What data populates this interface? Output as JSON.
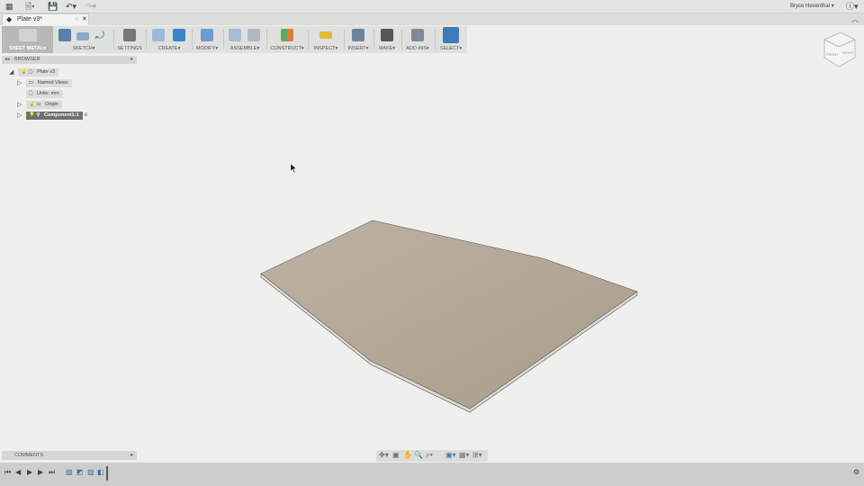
{
  "app": {
    "user_name": "Bryce Heventhal",
    "help_label": "?"
  },
  "document_tab": {
    "title": "Plate v3*"
  },
  "toolbar": {
    "workspace": "SHEET METAL",
    "groups": [
      {
        "label": "SKETCH",
        "dropdown": true
      },
      {
        "label": "SETTINGS",
        "dropdown": false
      },
      {
        "label": "CREATE",
        "dropdown": true
      },
      {
        "label": "MODIFY",
        "dropdown": true
      },
      {
        "label": "ASSEMBLE",
        "dropdown": true
      },
      {
        "label": "CONSTRUCT",
        "dropdown": true
      },
      {
        "label": "INSPECT",
        "dropdown": true
      },
      {
        "label": "INSERT",
        "dropdown": true
      },
      {
        "label": "MAKE",
        "dropdown": true
      },
      {
        "label": "ADD-INS",
        "dropdown": true
      },
      {
        "label": "SELECT",
        "dropdown": true
      }
    ]
  },
  "browser": {
    "title": "BROWSER",
    "nodes": [
      {
        "label": "Plate v3"
      },
      {
        "label": "Named Views"
      },
      {
        "label": "Units: mm"
      },
      {
        "label": "Origin"
      },
      {
        "label": "Component1:1"
      }
    ]
  },
  "viewcube": {
    "front": "FRONT",
    "right": "RIGHT"
  },
  "comments": {
    "title": "COMMENTS"
  },
  "colors": {
    "plate_top": "#b3a795",
    "plate_edge": "#d8d6d2",
    "select_active": "#3d7ab8"
  }
}
